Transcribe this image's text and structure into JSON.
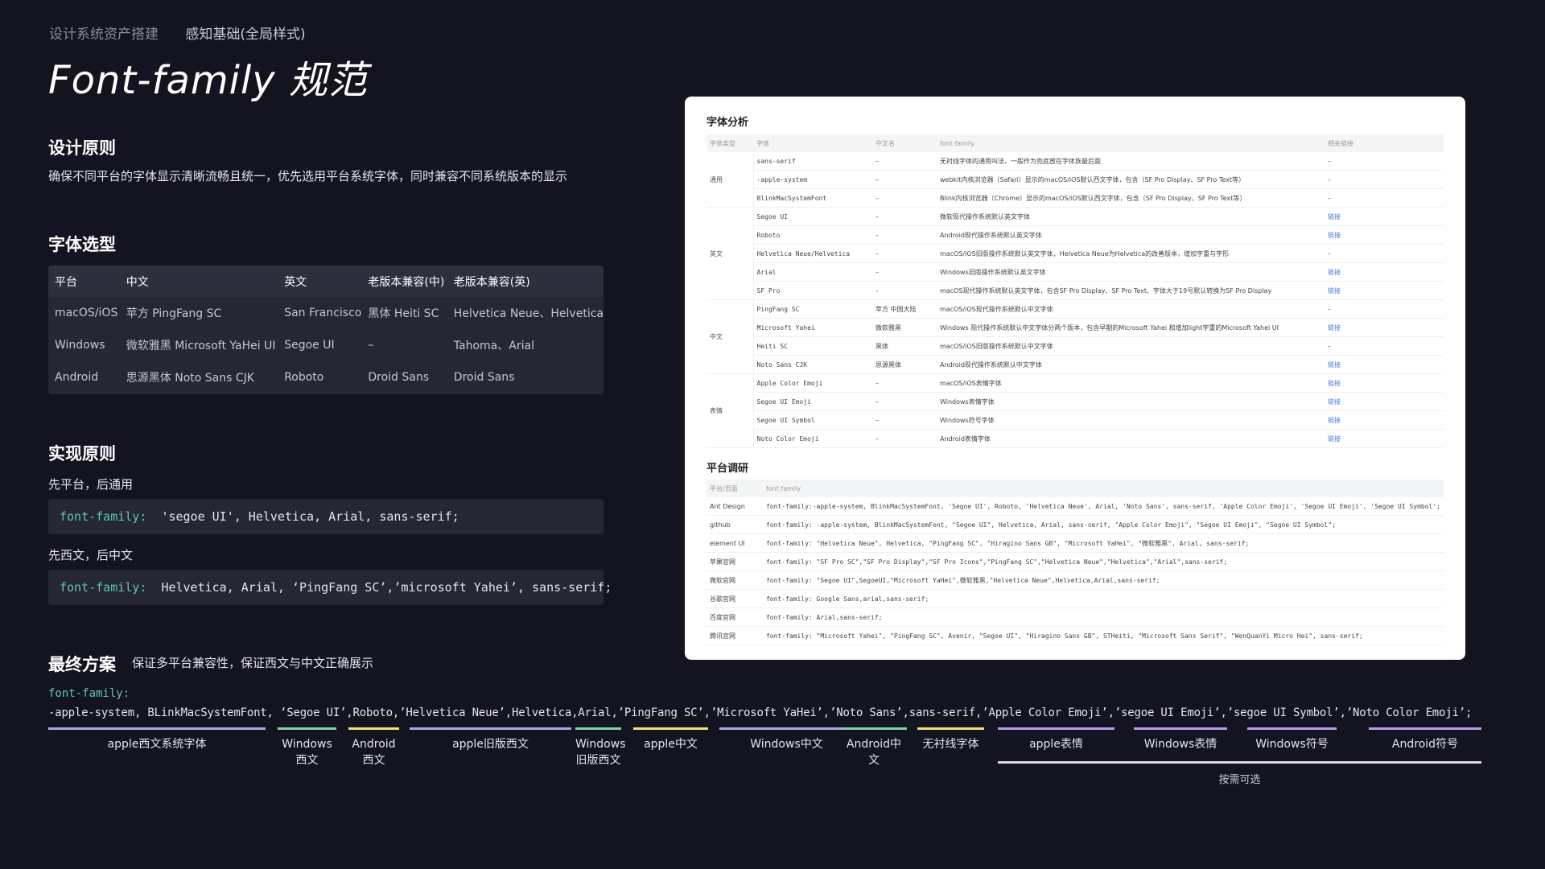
{
  "breadcrumb": {
    "parent": "设计系统资产搭建",
    "current": "感知基础(全局样式)"
  },
  "page_title": "Font-family 规范",
  "principle": {
    "title": "设计原则",
    "desc": "确保不同平台的字体显示清晰流畅且统一，优先选用平台系统字体，同时兼容不同系统版本的显示"
  },
  "selection": {
    "title": "字体选型",
    "headers": [
      "平台",
      "中文",
      "英文",
      "老版本兼容(中)",
      "老版本兼容(英)"
    ],
    "rows": [
      [
        "macOS/iOS",
        "苹方 PingFang SC",
        "San Francisco",
        "黑体 Heiti SC",
        "Helvetica Neue、Helvetica"
      ],
      [
        "Windows",
        "微软雅黑 Microsoft YaHei UI",
        "Segoe UI",
        "–",
        "Tahoma、Arial"
      ],
      [
        "Android",
        "思源黑体 Noto Sans CJK",
        "Roboto",
        "Droid Sans",
        "Droid Sans"
      ]
    ]
  },
  "implementation": {
    "title": "实现原则",
    "rule1": "先平台，后通用",
    "code1_key": "font-family:",
    "code1_val": "'segoe UI', Helvetica, Arial, sans-serif;",
    "rule2": "先西文，后中文",
    "code2_key": "font-family:",
    "code2_val": "Helvetica, Arial, ‘PingFang SC’,’microsoft Yahei’, sans-serif;"
  },
  "final": {
    "title": "最终方案",
    "desc": "保证多平台兼容性，保证西文与中文正确展示",
    "key": "font-family:",
    "value": "-apple-system, BLinkMacSystemFont, ‘Segoe UI’,Roboto,’Helvetica Neue’,Helvetica,Arial,’PingFang SC’,’Microsoft YaHei’,’Noto Sans’,sans-serif,’Apple Color Emoji’,’segoe UI Emoji’,’segoe UI Symbol’,’Noto Color Emoji’;",
    "segments": [
      {
        "label": "apple西文系统字体",
        "color": "#a9a6f0"
      },
      {
        "label": "Windows\n西文",
        "color": "#7fd6a8"
      },
      {
        "label": "Android\n西文",
        "color": "#f3e27a"
      },
      {
        "label": "apple旧版西文",
        "color": "#a9a6f0"
      },
      {
        "label": "Windows\n旧版西文",
        "color": "#7fd6a8"
      },
      {
        "label": "apple中文",
        "color": "#f3e27a"
      },
      {
        "label": "Windows中文",
        "color": "#a9a6f0"
      },
      {
        "label": "Android中文",
        "color": "#7fd6a8"
      },
      {
        "label": "无衬线字体",
        "color": "#f3e27a"
      },
      {
        "label": "apple表情",
        "color": "#b59af0"
      },
      {
        "label": "Windows表情",
        "color": "#b59af0"
      },
      {
        "label": "Windows符号",
        "color": "#b59af0"
      },
      {
        "label": "Android符号",
        "color": "#b59af0"
      }
    ],
    "optional_label": "按需可选"
  },
  "analysis_card": {
    "font_title": "字体分析",
    "font_headers": [
      "字体类型",
      "字体",
      "中文名",
      "font family",
      "相关链接"
    ],
    "font_groups": [
      {
        "group": "通用",
        "rows": [
          [
            "sans-serif",
            "–",
            "无衬线字体的通用叫法，一般作为兜底放在字体族最后面",
            "–"
          ],
          [
            "-apple-system",
            "–",
            "webkit内核浏览器（Safari）显示的macOS/iOS默认西文字体，包含（SF Pro Display、SF Pro Text等）",
            "–"
          ],
          [
            "BlinkMacSystemFont",
            "–",
            "Blink内核浏览器（Chrome）显示的macOS/iOS默认西文字体，包含（SF Pro Display、SF Pro Text等）",
            "–"
          ]
        ]
      },
      {
        "group": "英文",
        "rows": [
          [
            "Segoe UI",
            "–",
            "微软现代操作系统默认英文字体",
            "链接"
          ],
          [
            "Roboto",
            "–",
            "Android现代操作系统默认英文字体",
            "链接"
          ],
          [
            "Helvetica Neue/Helvetica",
            "–",
            "macOS/iOS旧版操作系统默认英文字体，Helvetica Neue为Helvetica的改善版本，增加字重与字形",
            "–"
          ],
          [
            "Arial",
            "–",
            "Windows旧版操作系统默认英文字体",
            "链接"
          ],
          [
            "SF Pro",
            "–",
            "macOS现代操作系统默认英文字体，包含SF Pro Display、SF Pro Text、字体大于19号默认转换为SF Pro Display",
            "链接"
          ]
        ]
      },
      {
        "group": "中文",
        "rows": [
          [
            "PingFang SC",
            "苹方 中国大陆",
            "macOS/iOS现代操作系统默认中文字体",
            "–"
          ],
          [
            "Microsoft Yahei",
            "微软雅黑",
            "Windows 现代操作系统默认中文字体分两个版本，包含早期的Microsoft Yahei 和增加light字重的Microsoft Yahei UI",
            "链接"
          ],
          [
            "Heiti SC",
            "黑体",
            "macOS/iOS旧版操作系统默认中文字体",
            "–"
          ],
          [
            "Noto Sans CJK",
            "思源黑体",
            "Android现代操作系统默认中文字体",
            "链接"
          ]
        ]
      },
      {
        "group": "表情",
        "rows": [
          [
            "Apple Color Emoji",
            "–",
            "macOS/iOS表情字体",
            "链接"
          ],
          [
            "Segoe UI Emoji",
            "–",
            "Windows表情字体",
            "链接"
          ],
          [
            "Segoe UI Symbol",
            "–",
            "Windows符号字体",
            "链接"
          ],
          [
            "Noto Color Emoji",
            "–",
            "Android表情字体",
            "链接"
          ]
        ]
      }
    ],
    "platform_title": "平台调研",
    "platform_headers": [
      "平台/页面",
      "font family"
    ],
    "platform_rows": [
      [
        "Ant Design",
        "font-family:-apple-system, BlinkMacSystemFont, 'Segoe UI', Roboto, 'Helvetica Neue', Arial, 'Noto Sans', sans-serif, 'Apple Color Emoji', 'Segoe UI Emoji', 'Segoe UI Symbol';"
      ],
      [
        "github",
        "font-family: -apple-system, BlinkMacSystemFont, \"Segoe UI\", Helvetica, Arial, sans-serif, \"Apple Color Emoji\", \"Segoe UI Emoji\", \"Segoe UI Symbol\";"
      ],
      [
        "element UI",
        "font-family: \"Helvetica Neue\", Helvetica, \"PingFang SC\", \"Hiragino Sans GB\", \"Microsoft YaHei\", \"微软雅黑\", Arial, sans-serif;"
      ],
      [
        "苹果官网",
        "font-family: \"SF Pro SC\",\"SF Pro Display\",\"SF Pro Icons\",\"PingFang SC\",\"Helvetica Neue\",\"Helvetica\",\"Arial\",sans-serif;"
      ],
      [
        "微软官网",
        "font-family: \"Segoe UI\",SegoeUI,\"Microsoft YaHei\",微软雅黑,\"Helvetica Neue\",Helvetica,Arial,sans-serif;"
      ],
      [
        "谷歌官网",
        "font-family: Google Sans,arial,sans-serif;"
      ],
      [
        "百度官网",
        "font-family: Arial,sans-serif;"
      ],
      [
        "腾讯官网",
        "font-family: \"Microsoft Yahei\", \"PingFang SC\", Avenir, \"Segoe UI\", \"Hiragino Sans GB\", STHeiti, \"Microsoft Sans Serif\", \"WenQuanYi Micro Hei\", sans-serif;"
      ]
    ]
  }
}
